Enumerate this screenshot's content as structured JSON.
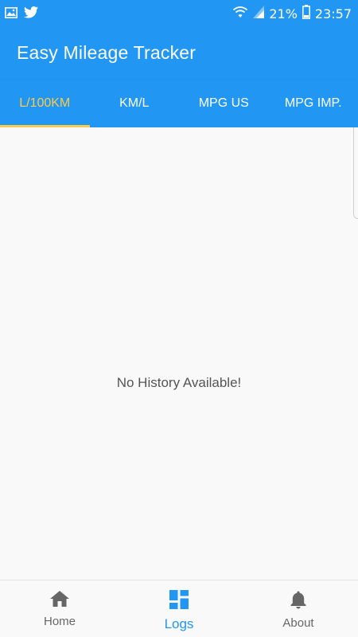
{
  "status_bar": {
    "battery_percent": "21%",
    "time": "23:57",
    "icons": [
      "image-icon",
      "twitter-icon",
      "wifi-icon",
      "signal-icon",
      "battery-icon"
    ]
  },
  "app_bar": {
    "title": "Easy Mileage Tracker"
  },
  "tabs": [
    {
      "label": "L/100KM",
      "active": true
    },
    {
      "label": "KM/L",
      "active": false
    },
    {
      "label": "MPG US",
      "active": false
    },
    {
      "label": "MPG IMP.",
      "active": false
    }
  ],
  "content": {
    "empty_message": "No History Available!"
  },
  "bottom_nav": [
    {
      "label": "Home",
      "icon": "home-icon",
      "active": false
    },
    {
      "label": "Logs",
      "icon": "dashboard-icon",
      "active": true
    },
    {
      "label": "About",
      "icon": "bell-icon",
      "active": false
    }
  ],
  "colors": {
    "primary": "#2196f3",
    "accent": "#ffc94a",
    "background": "#f9f9f9"
  }
}
